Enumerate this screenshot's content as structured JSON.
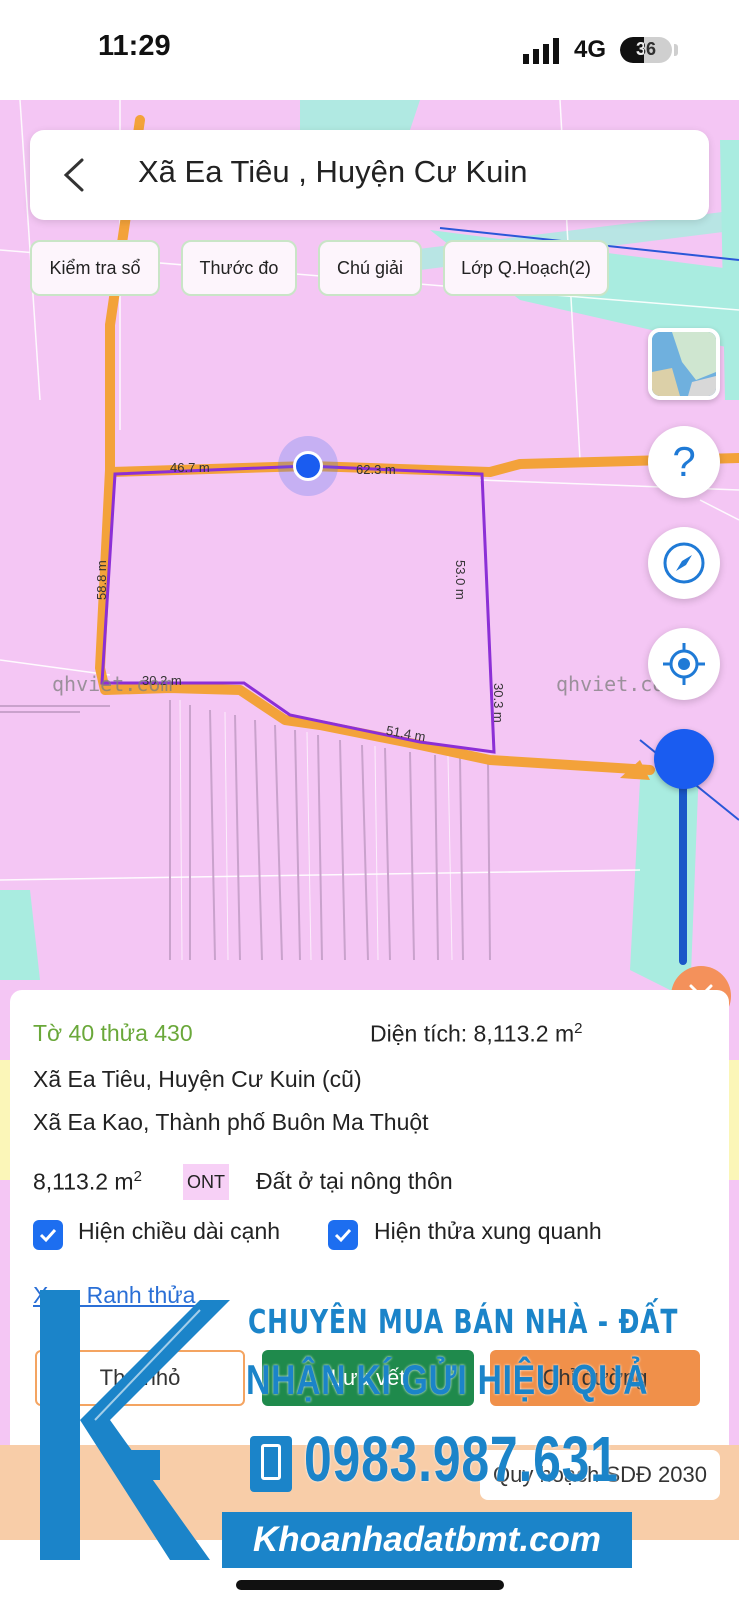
{
  "status_bar": {
    "time": "11:29",
    "network": "4G",
    "battery": "36"
  },
  "header": {
    "title": "Xã Ea Tiêu , Huyện Cư Kuin"
  },
  "chips": [
    "Kiểm tra sổ",
    "Thước đo",
    "Chú giải",
    "Lớp Q.Hoạch(2)"
  ],
  "map": {
    "watermark": "qhviet.com",
    "edges": [
      "46.7 m",
      "62.3 m",
      "53.0 m",
      "30.3 m",
      "51.4 m",
      "30.2 m",
      "58.8 m"
    ],
    "zoom_fraction": 0.92,
    "help_glyph": "?"
  },
  "panel": {
    "parcel": "Tờ 40 thửa 430",
    "area_label": "Diện tích: 8,113.2 m",
    "area_sup": "2",
    "address_old": "Xã Ea Tiêu, Huyện Cư Kuin (cũ)",
    "address_new": "Xã Ea Kao, Thành phố Buôn Ma Thuột",
    "land_size": "8,113.2 m",
    "land_size_sup": "2",
    "land_code": "ONT",
    "land_type": "Đất ở tại nông thôn",
    "checkbox_edge_length": "Hiện chiều dài cạnh",
    "checkbox_neighbors": "Hiện thửa xung quanh",
    "link": "Xem Ranh thửa",
    "btn_minimize": "Thu nhỏ",
    "btn_save": "Lưu vết",
    "btn_directions": "Chỉ đường"
  },
  "plan_label": "Quy hoạch SDĐ 2030",
  "ad": {
    "line1": "CHUYÊN MUA BÁN NHÀ - ĐẤT",
    "line2": "NHẬN KÍ GỬI HIỆU QUẢ",
    "phone": "0983.987.631",
    "website": "Khoanhadatbmt.com"
  },
  "icons": [
    "back-arrow-icon",
    "signal-icon",
    "battery-icon",
    "map-layer-icon",
    "help-icon",
    "compass-icon",
    "locate-icon",
    "close-icon",
    "check-icon",
    "phone-icon",
    "logo-k"
  ],
  "colors": {
    "land": "#f4c6f4",
    "road": "#f3a23a",
    "water": "#a9ece0",
    "parcel_border": "#8c2fd6",
    "location": "#1a5cf0",
    "brand": "#1b84c9"
  }
}
